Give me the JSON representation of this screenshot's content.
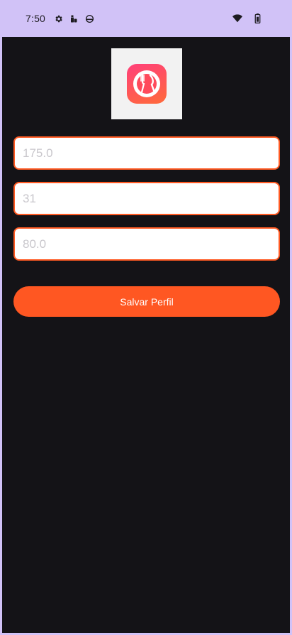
{
  "status_bar": {
    "time": "7:50",
    "icons": [
      "gear-icon",
      "sim-icon",
      "android-head-icon",
      "wifi-icon",
      "battery-icon"
    ]
  },
  "logo": {
    "icon": "fork-knife-plate-icon"
  },
  "form": {
    "height_placeholder": "175.0",
    "age_placeholder": "31",
    "weight_placeholder": "80.0"
  },
  "save_button": {
    "label": "Salvar Perfil"
  },
  "colors": {
    "status_bar": "#d1c2f7",
    "background": "#141317",
    "accent": "#ff5722",
    "field_border": "#ff5a23"
  }
}
